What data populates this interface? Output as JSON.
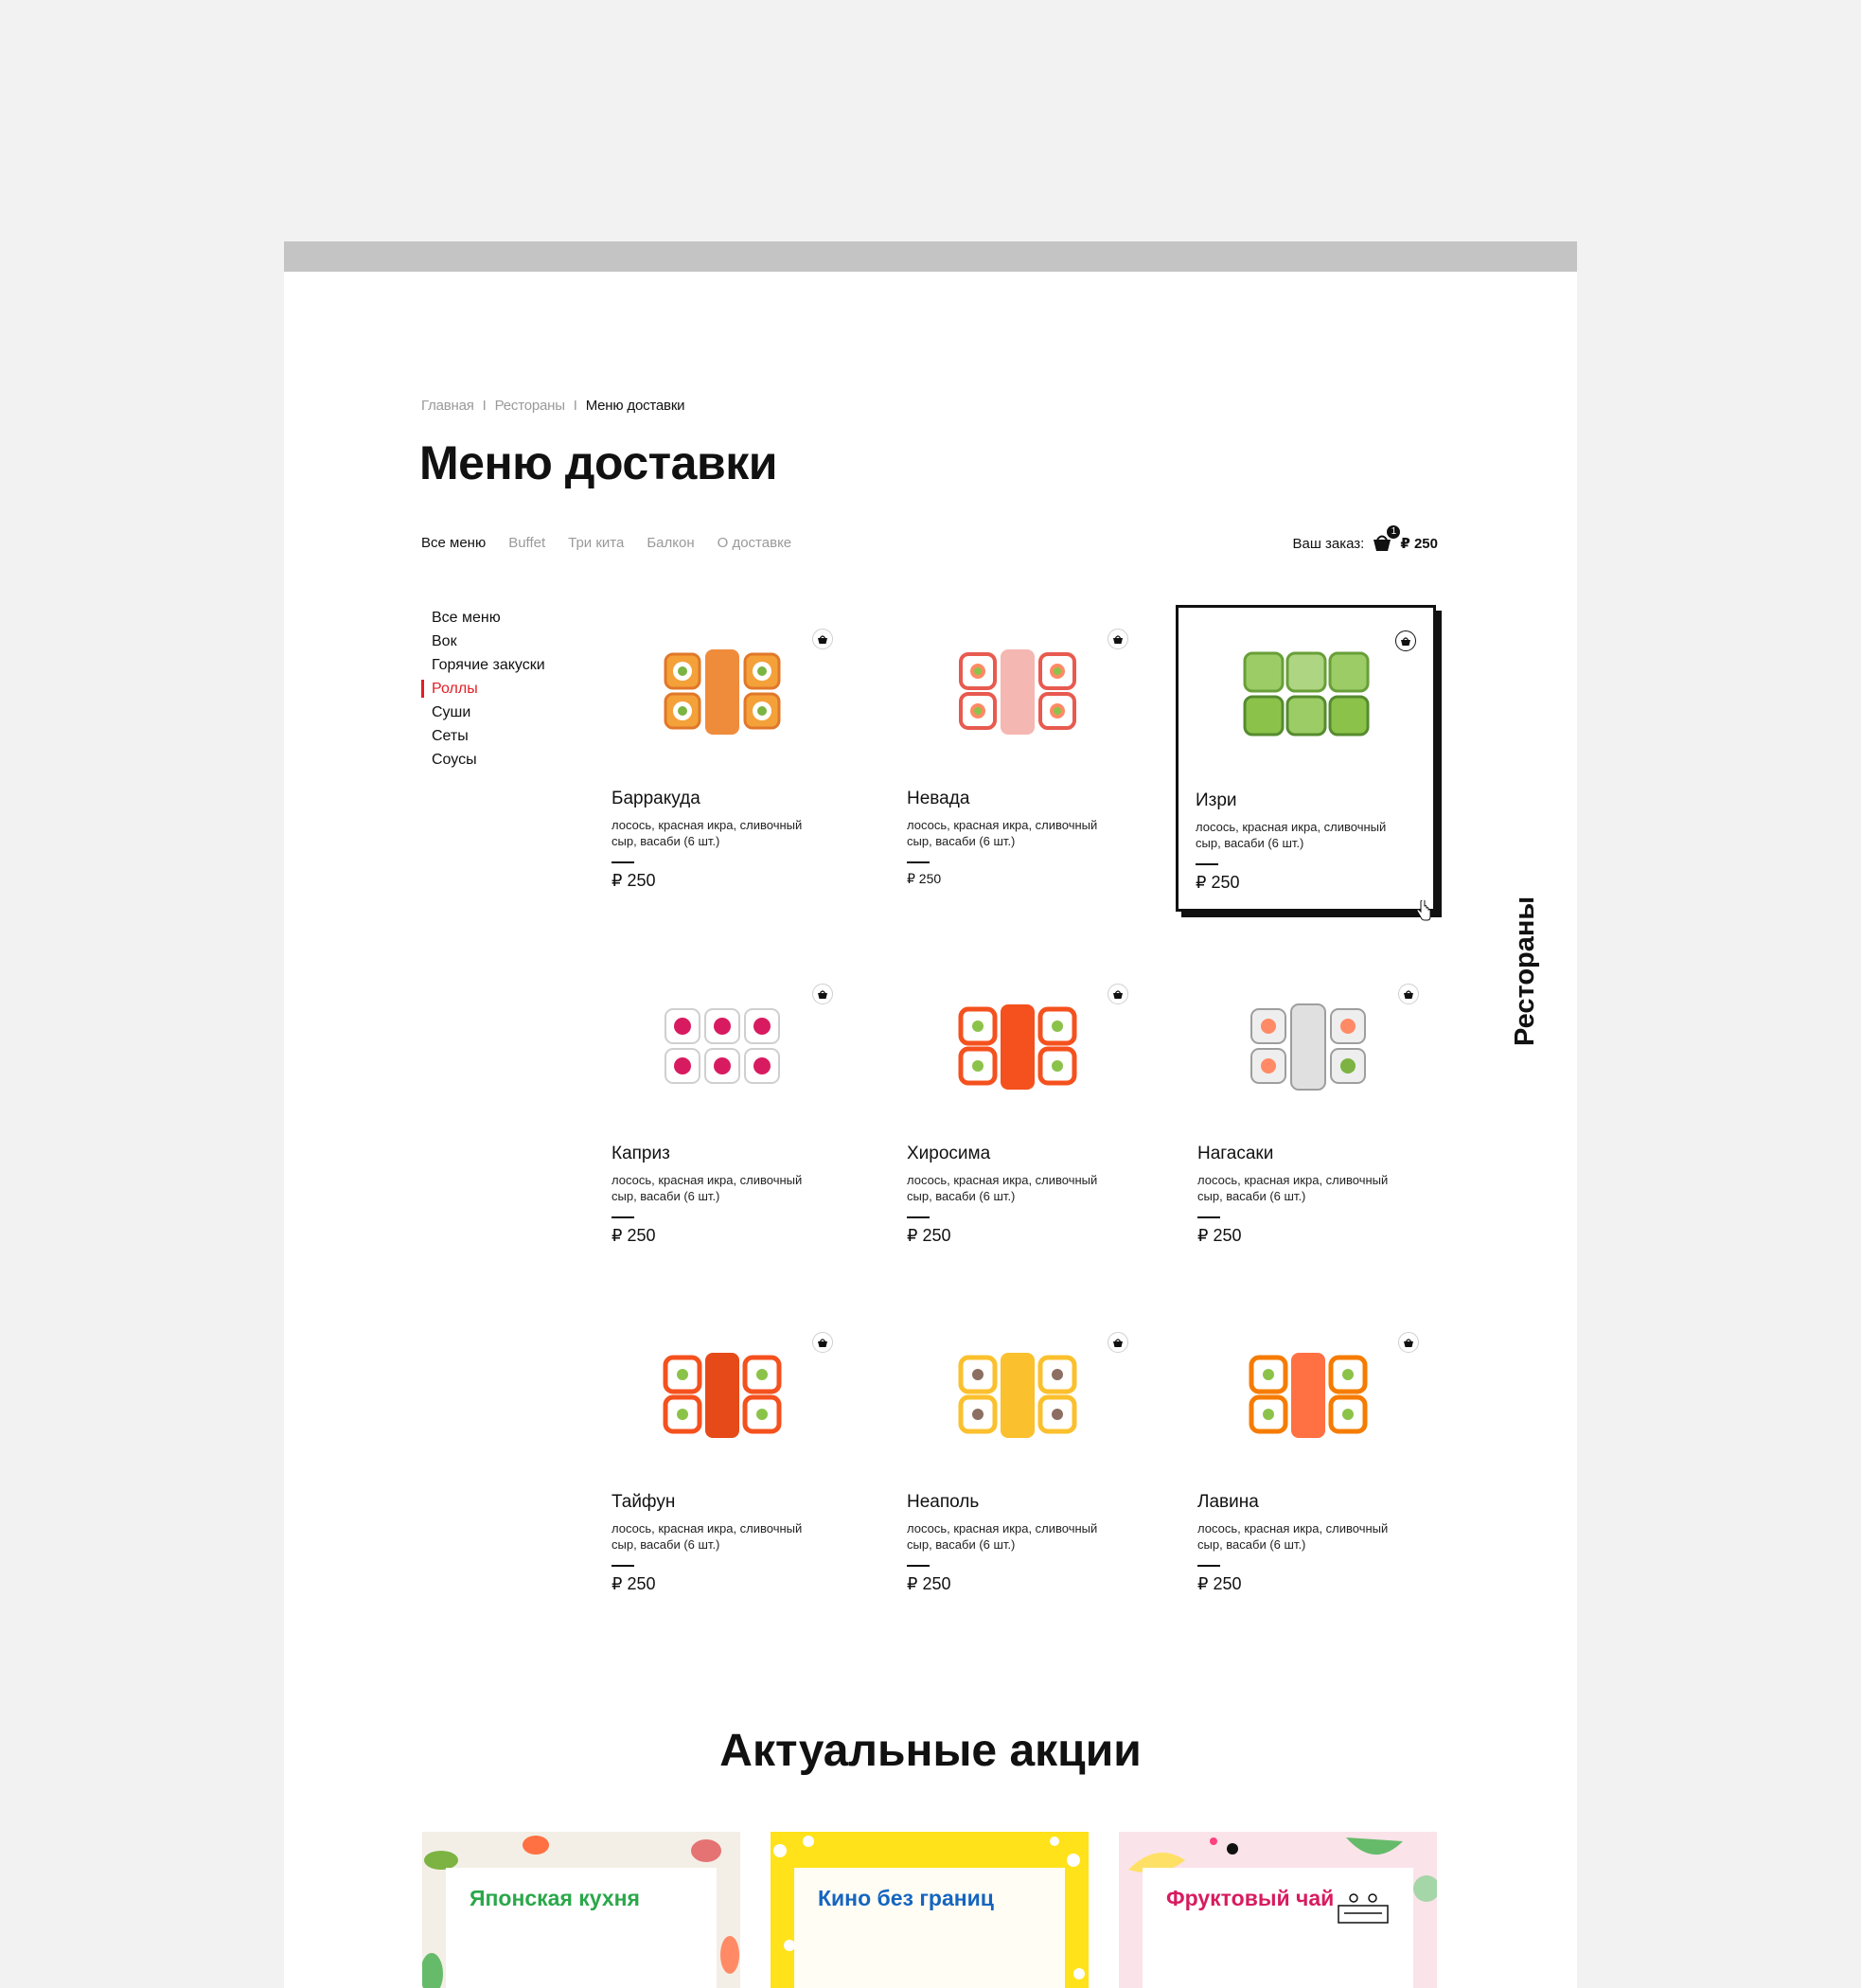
{
  "breadcrumb": {
    "items": [
      "Главная",
      "Рестораны",
      "Меню доставки"
    ],
    "separator": "I"
  },
  "page": {
    "title": "Меню доставки"
  },
  "top_nav": {
    "tabs": [
      {
        "label": "Все меню",
        "active": true
      },
      {
        "label": "Buffet",
        "active": false
      },
      {
        "label": "Три кита",
        "active": false
      },
      {
        "label": "Балкон",
        "active": false
      },
      {
        "label": "О доставке",
        "active": false
      }
    ]
  },
  "order": {
    "label": "Ваш заказ:",
    "count": "1",
    "total": "₽ 250",
    "icon": "basket-icon"
  },
  "categories": [
    {
      "label": "Все меню",
      "active": false
    },
    {
      "label": "Вок",
      "active": false
    },
    {
      "label": "Горячие закуски",
      "active": false
    },
    {
      "label": "Роллы",
      "active": true
    },
    {
      "label": "Суши",
      "active": false
    },
    {
      "label": "Сеты",
      "active": false
    },
    {
      "label": "Соусы",
      "active": false
    }
  ],
  "products": [
    {
      "name": "Барракуда",
      "desc": "лосось, красная икра, сливочный сыр, васаби (6 шт.)",
      "price": "₽ 250"
    },
    {
      "name": "Невада",
      "desc": "лосось, красная икра, сливочный сыр, васаби (6 шт.)",
      "price": "₽ 250"
    },
    {
      "name": "Изри",
      "desc": "лосось, красная икра, сливочный сыр, васаби (6 шт.)",
      "price": "₽ 250"
    },
    {
      "name": "Каприз",
      "desc": "лосось, красная икра, сливочный сыр, васаби (6 шт.)",
      "price": "₽ 250"
    },
    {
      "name": "Хиросима",
      "desc": "лосось, красная икра, сливочный сыр, васаби (6 шт.)",
      "price": "₽ 250"
    },
    {
      "name": "Нагасаки",
      "desc": "лосось, красная икра, сливочный сыр, васаби (6 шт.)",
      "price": "₽ 250"
    },
    {
      "name": "Тайфун",
      "desc": "лосось, красная икра, сливочный сыр, васаби (6 шт.)",
      "price": "₽ 250"
    },
    {
      "name": "Неаполь",
      "desc": "лосось, красная икра, сливочный сыр, васаби (6 шт.)",
      "price": "₽ 250"
    },
    {
      "name": "Лавина",
      "desc": "лосось, красная икра, сливочный сыр, васаби (6 шт.)",
      "price": "₽ 250"
    }
  ],
  "side_label": "Рестораны",
  "promos": {
    "title": "Актуальные акции",
    "items": [
      {
        "label": "Японская кухня",
        "color": "#2aa84a",
        "bg": "#f3efe6"
      },
      {
        "label": "Кино без границ",
        "color": "#1565c0",
        "bg": "#ffe21a"
      },
      {
        "label": "Фруктовый чай",
        "color": "#d81b60",
        "bg": "#fbe3ea"
      }
    ]
  },
  "colors": {
    "accent": "#e31e24",
    "text": "#111111",
    "muted": "#9a9a9a",
    "page_bg": "#f2f2f2"
  }
}
